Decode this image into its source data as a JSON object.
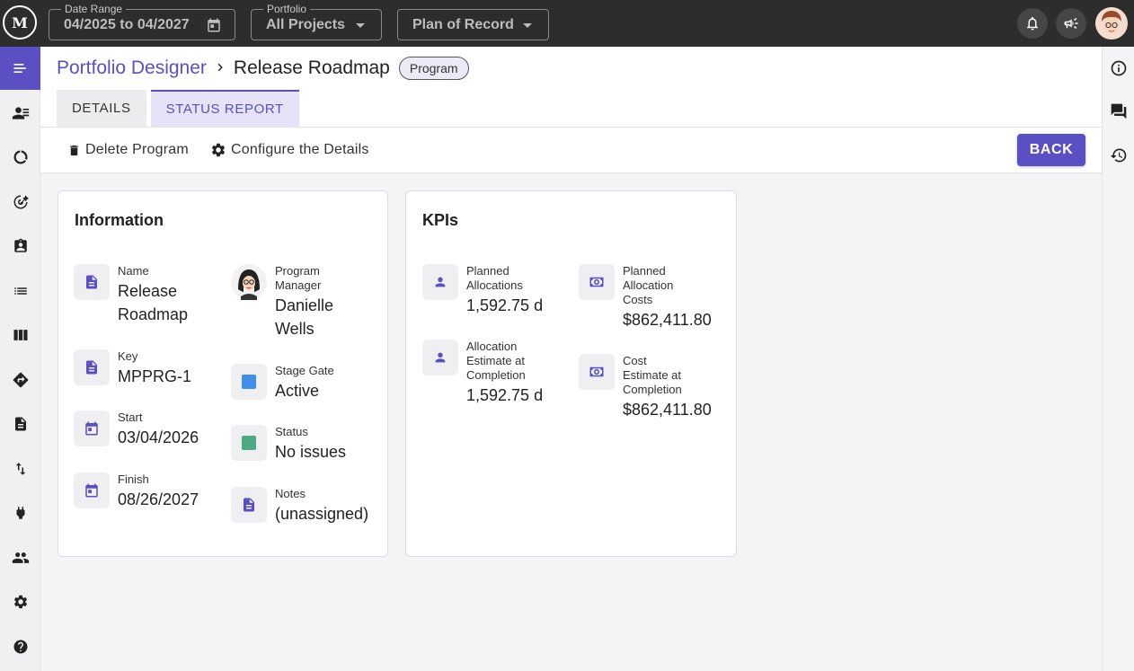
{
  "topbar": {
    "logo_text": "M",
    "date_range": {
      "label": "Date Range",
      "value": "04/2025 to 04/2027"
    },
    "portfolio": {
      "label": "Portfolio",
      "value": "All Projects"
    },
    "plan": {
      "value": "Plan of Record"
    }
  },
  "breadcrumb": {
    "parent": "Portfolio Designer",
    "current": "Release Roadmap",
    "chip": "Program"
  },
  "tabs": [
    {
      "label": "DETAILS"
    },
    {
      "label": "STATUS REPORT"
    }
  ],
  "actions": {
    "delete": "Delete Program",
    "configure": "Configure the Details",
    "back": "BACK"
  },
  "information": {
    "title": "Information",
    "name": {
      "label": "Name",
      "value": "Release Roadmap"
    },
    "program_manager": {
      "label": "Program Manager",
      "value": "Danielle Wells"
    },
    "key": {
      "label": "Key",
      "value": "MPPRG-1"
    },
    "stage_gate": {
      "label": "Stage Gate",
      "value": "Active",
      "color": "#3d8fe8"
    },
    "start": {
      "label": "Start",
      "value": "03/04/2026"
    },
    "status": {
      "label": "Status",
      "value": "No issues",
      "color": "#4caa84"
    },
    "finish": {
      "label": "Finish",
      "value": "08/26/2027"
    },
    "notes": {
      "label": "Notes",
      "value": "(unassigned)"
    }
  },
  "kpis": {
    "title": "KPIs",
    "planned_allocations": {
      "label": "Planned Allocations",
      "value": "1,592.75 d"
    },
    "planned_allocation_costs": {
      "label": "Planned Allocation Costs",
      "value": "$862,411.80"
    },
    "allocation_eac": {
      "label": "Allocation Estimate at Completion",
      "value": "1,592.75 d"
    },
    "cost_eac": {
      "label": "Cost Estimate at Completion",
      "value": "$862,411.80"
    }
  },
  "colors": {
    "accent": "#5a4fc3",
    "topbar": "#2d2d2d"
  }
}
